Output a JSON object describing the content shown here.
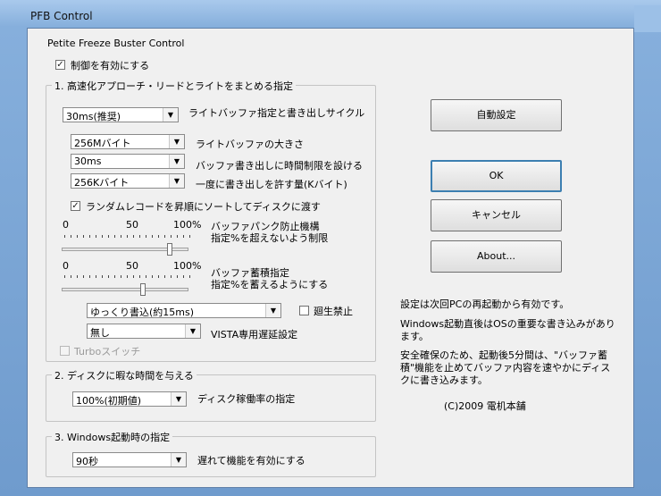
{
  "window": {
    "title": "PFB   Control"
  },
  "app_caption": "Petite Freeze Buster Control",
  "enable_control": {
    "label": "制御を有効にする",
    "checked": true
  },
  "section1": {
    "title": "1. 高速化アプローチ・リードとライトをまとめる指定",
    "write_cycle": {
      "value": "30ms(推奨)",
      "label": "ライトバッファ指定と書き出しサイクル"
    },
    "buffer_size": {
      "value": "256Mバイト",
      "label": "ライトバッファの大きさ"
    },
    "time_limit": {
      "value": "30ms",
      "label": "バッファ書き出しに時間制限を設ける"
    },
    "write_amount": {
      "value": "256Kバイト",
      "label": "一度に書き出しを許す量(Kバイト)"
    },
    "random_sort": {
      "label": "ランダムレコードを昇順にソートしてディスクに渡す",
      "checked": true
    },
    "slider1": {
      "min": "0",
      "mid": "50",
      "max": "100%",
      "label_line1": "バッファパンク防止機構",
      "label_line2": "指定%を超えないよう制限",
      "value": 0.85
    },
    "slider2": {
      "min": "0",
      "mid": "50",
      "max": "100%",
      "label_line1": "バッファ蓄積指定",
      "label_line2": "指定%を蓄えるようにする",
      "value": 0.64
    },
    "write_mode": {
      "value": "ゆっくり書込(約15ms)"
    },
    "regen_ban": {
      "label": "廻生禁止",
      "checked": false
    },
    "vista_delay": {
      "value": "無し",
      "label": "VISTA専用遅延設定"
    },
    "turbo": {
      "label": "Turboスイッチ",
      "checked": false,
      "disabled": true
    }
  },
  "section2": {
    "title": "2. ディスクに暇な時間を与える",
    "disk_rate": {
      "value": "100%(初期値)",
      "label": "ディスク稼働率の指定"
    }
  },
  "section3": {
    "title": "3. Windows起動時の指定",
    "delay": {
      "value": "90秒",
      "label": "遅れて機能を有効にする"
    }
  },
  "buttons": {
    "auto": "自動設定",
    "ok": "OK",
    "cancel": "キャンセル",
    "about": "About..."
  },
  "notes": {
    "n1": "設定は次回PCの再起動から有効です。",
    "n2a": "Windows起動直後はOSの重要な書き込みがあり",
    "n2b": "ます。",
    "n3a": "安全確保のため、起動後5分間は、\"バッファ蓄",
    "n3b": "積\"機能を止めてバッファ内容を速やかにディス",
    "n3c": "クに書き込みます。",
    "copyright": "(C)2009 電机本舗"
  },
  "icons": {
    "dropdown": "chevron-down-icon",
    "check": "checkmark-icon"
  }
}
